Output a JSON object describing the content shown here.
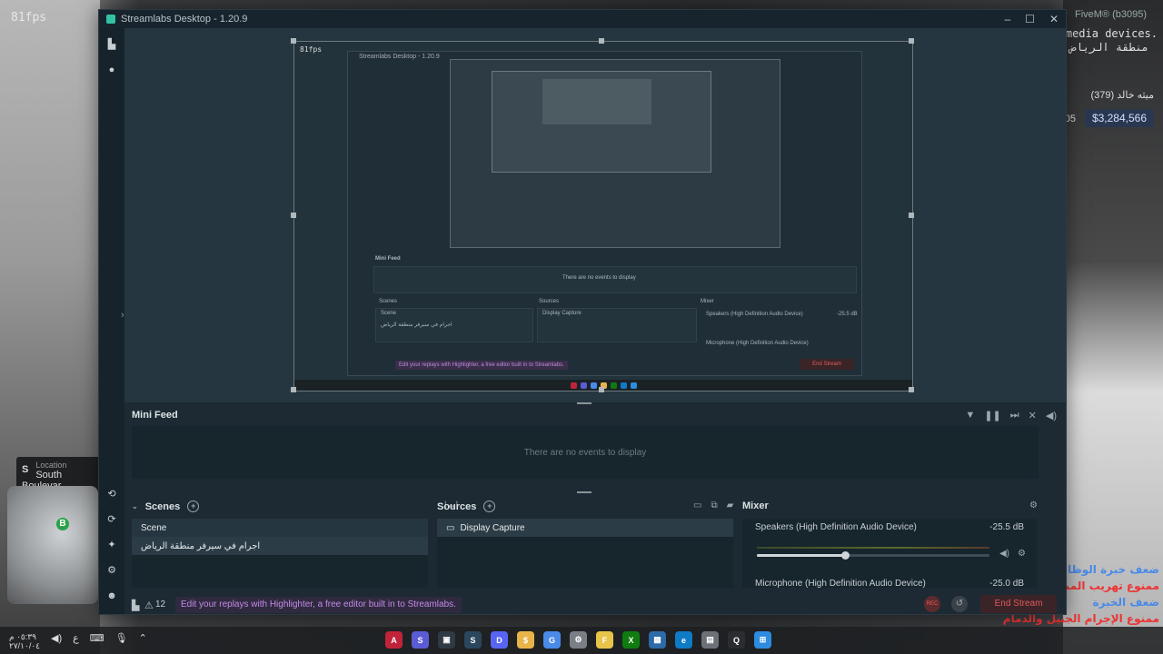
{
  "overlay": {
    "fps": "81fps",
    "fivem": "FiveM® (b3095)",
    "media_devices": "s media devices.",
    "region": "منطقة الرياض",
    "player_line": "ميثه خالد (379)",
    "money": "$3,284,566",
    "money_prefix": "05",
    "red_lines": [
      "ضعف خبرة الوظائف",
      "ممنوع تهريب الممنو",
      "ضعف الخبرة",
      "ممنوع الإجرام الجبيل والدمام"
    ],
    "location_label": "Location",
    "location_value": "South Boulevar",
    "location_letter": "S",
    "minimap_badge": "B"
  },
  "window": {
    "title": "Streamlabs Desktop - 1.20.9",
    "minimize": "–",
    "maximize": "☐",
    "close": "✕"
  },
  "preview": {
    "fps": "81fps",
    "title": "Streamlabs Desktop - 1.20.9",
    "mini_feed": "Mini Feed",
    "no_events": "There are no events to display",
    "scenes": "Scenes",
    "sources": "Sources",
    "mixer": "Mixer",
    "scene_item": "Scene",
    "scene_item2": "اجرام في سيرفر منطقة الرياض",
    "source_item": "Display Capture",
    "speakers": "Speakers (High Definition Audio Device)",
    "speakers_db": "-25.5 dB",
    "microphone": "Microphone (High Definition Audio Device)",
    "banner": "Edit your replays with Highlighter, a free editor built in to Streamlabs.",
    "end": "End Stream",
    "count": "12"
  },
  "minifeed": {
    "title": "Mini Feed",
    "empty": "There are no events to display"
  },
  "scenes": {
    "title": "Scenes",
    "items": [
      "Scene",
      "اجرام في سيرفر منطقة الرياض"
    ]
  },
  "sources": {
    "title": "Sources",
    "items": [
      "Display Capture"
    ]
  },
  "mixer": {
    "title": "Mixer",
    "speakers_name": "Speakers (High Definition Audio Device)",
    "speakers_db": "-25.5 dB",
    "speakers_volume": 0.38,
    "mic_name": "Microphone (High Definition Audio Device)",
    "mic_db": "-25.0 dB"
  },
  "footer": {
    "notif_count": "12",
    "banner": "Edit your replays with Highlighter, a free editor built in to Streamlabs.",
    "rec_label": "REC",
    "end_stream": "End Stream"
  },
  "taskbar": {
    "time": "٠٥:٣٩ م",
    "date": "٢٧/١٠/٠٤",
    "lang": "ع",
    "apps": [
      "A",
      "S",
      "▣",
      "S",
      "D",
      "$",
      "G",
      "⚙",
      "F",
      "X",
      "▦",
      "e",
      "▤",
      "Q",
      "⊞"
    ],
    "app_colors": [
      "#c0243a",
      "#5b5bd6",
      "#2f3a44",
      "#2a475e",
      "#5865f2",
      "#e8b44a",
      "#4a8ae8",
      "#7a7f86",
      "#e8c44a",
      "#107c10",
      "#2d6aa8",
      "#0f7ac6",
      "#6c7178",
      "#2b2d30",
      "#2d8ce0"
    ]
  },
  "colors": {
    "accent": "#31c3a2",
    "end_stream": "#e05a5a",
    "banner": "#c48be6"
  }
}
